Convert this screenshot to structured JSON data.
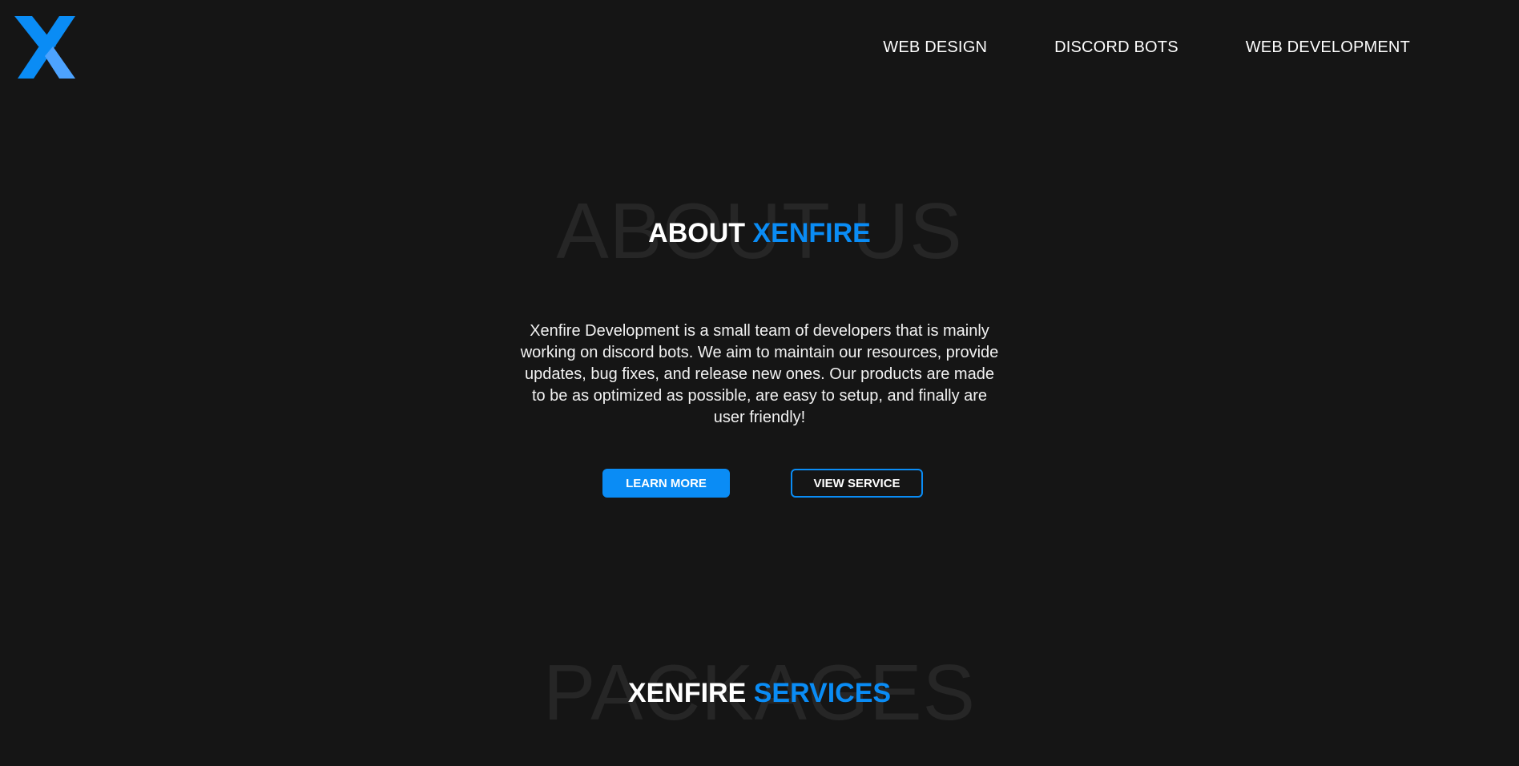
{
  "header": {
    "logo_name": "xenfire-logo",
    "nav": [
      {
        "label": "WEB DESIGN"
      },
      {
        "label": "DISCORD BOTS"
      },
      {
        "label": "WEB DEVELOPMENT"
      }
    ]
  },
  "about": {
    "bg_word": "ABOUT US",
    "title_main": "ABOUT",
    "title_accent": "XENFIRE",
    "description": "Xenfire Development is a small team of developers that is mainly working on discord bots. We aim to maintain our resources, provide updates, bug fixes, and release new ones. Our products are made to be as optimized as possible, are easy to setup, and finally are user friendly!",
    "learn_more_label": "LEARN MORE",
    "view_service_label": "VIEW SERVICE"
  },
  "packages": {
    "bg_word": "PACKAGES",
    "title_main": "XENFIRE",
    "title_accent": "SERVICES"
  },
  "colors": {
    "background": "#151515",
    "accent": "#0a8cf5",
    "accent_light": "#4da3ff",
    "bg_word": "#262626"
  }
}
